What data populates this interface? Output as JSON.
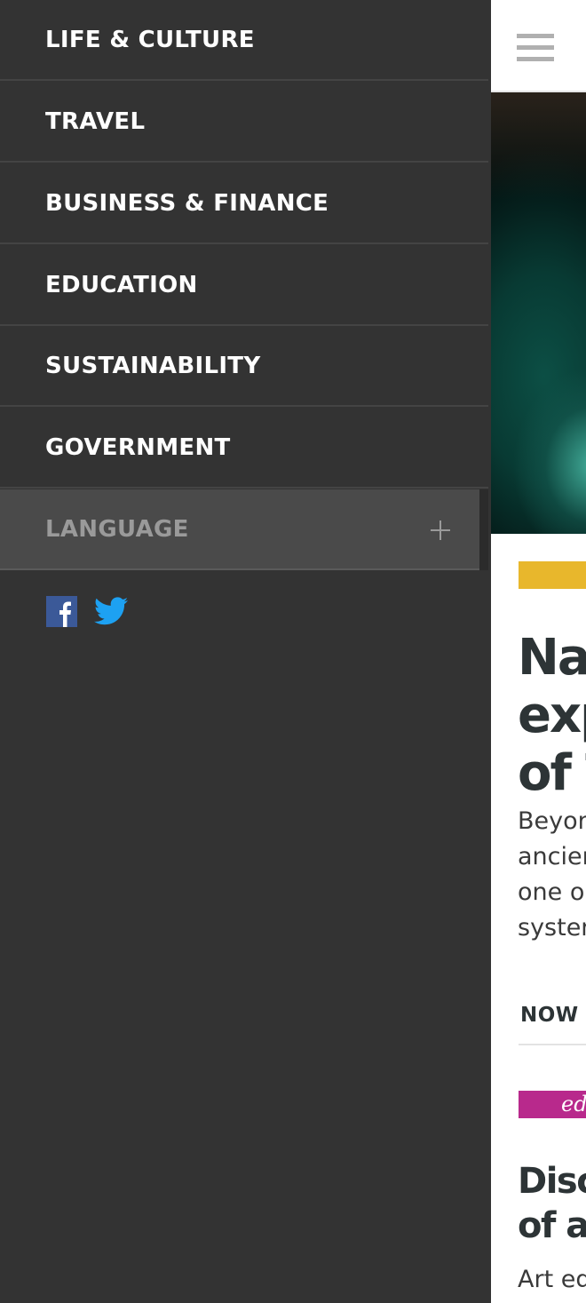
{
  "drawer": {
    "menu_items": [
      {
        "label": "LIFE & CULTURE"
      },
      {
        "label": "TRAVEL"
      },
      {
        "label": "BUSINESS & FINANCE"
      },
      {
        "label": "EDUCATION"
      },
      {
        "label": "SUSTAINABILITY"
      },
      {
        "label": "GOVERNMENT"
      }
    ],
    "language": {
      "label": "LANGUAGE",
      "expand_icon": "plus-icon"
    },
    "social": {
      "facebook_icon": "facebook-icon",
      "twitter_icon": "twitter-icon"
    }
  },
  "page": {
    "menu_icon": "hamburger-icon",
    "featured": {
      "tag_color": "#e8b72c",
      "headline": "Na\nexp\nof T",
      "summary": "Beyon\nancier\none o\nsysten"
    },
    "section_label": "NOW",
    "second_story": {
      "tag": "ed",
      "tag_color": "#b8298c",
      "headline": "Disc\nof ar",
      "summary": "Art ed\nthis co"
    }
  },
  "colors": {
    "drawer_bg": "#333333",
    "divider": "#444444",
    "language_bg": "#4a4a4a",
    "facebook": "#3b5998",
    "twitter": "#1da1f2",
    "text_dark": "#2d3436"
  }
}
